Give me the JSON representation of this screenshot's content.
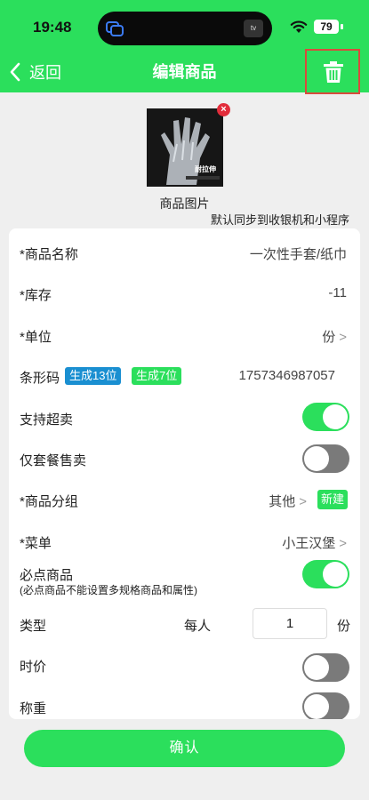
{
  "status_bar": {
    "time": "19:48",
    "battery": "79"
  },
  "nav": {
    "back_label": "返回",
    "title": "编辑商品"
  },
  "photo": {
    "label": "商品图片",
    "sync_note": "默认同步到收银机和小程序",
    "caption": "耐拉伸"
  },
  "form": {
    "name": {
      "label": "*商品名称",
      "value": "一次性手套/纸巾"
    },
    "stock": {
      "label": "*库存",
      "value": "-11"
    },
    "unit": {
      "label": "*单位",
      "value": "份"
    },
    "barcode": {
      "label": "条形码",
      "gen13": "生成13位",
      "gen7": "生成7位",
      "value": "1757346987057"
    },
    "oversell": {
      "label": "支持超卖",
      "on": true
    },
    "combo_only": {
      "label": "仅套餐售卖",
      "on": false
    },
    "group": {
      "label": "*商品分组",
      "value": "其他",
      "new_label": "新建"
    },
    "menu": {
      "label": "*菜单",
      "value": "小王汉堡"
    },
    "required": {
      "label": "必点商品",
      "note": "(必点商品不能设置多规格商品和属性)",
      "on": true
    },
    "type": {
      "label": "类型",
      "per": "每人",
      "qty": "1",
      "unit": "份"
    },
    "market_price": {
      "label": "时价",
      "on": false
    },
    "weighed": {
      "label": "称重",
      "on": false
    }
  },
  "confirm_label": "确认",
  "colors": {
    "accent": "#2bdf5c",
    "tag_blue": "#1a8fd1",
    "delete_highlight": "#d94a3c",
    "toggle_off": "#7a7a7a"
  }
}
